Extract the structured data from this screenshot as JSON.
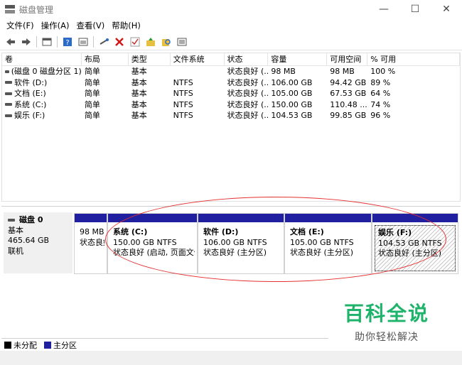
{
  "window": {
    "title": "磁盘管理",
    "minimize": "—",
    "maximize": "☐",
    "close": "✕"
  },
  "menu": [
    "文件(F)",
    "操作(A)",
    "查看(V)",
    "帮助(H)"
  ],
  "columns": [
    "卷",
    "布局",
    "类型",
    "文件系统",
    "状态",
    "容量",
    "可用空间",
    "% 可用"
  ],
  "volumes": [
    [
      "(磁盘 0 磁盘分区 1)",
      "简单",
      "基本",
      "",
      "状态良好 (...",
      "98 MB",
      "98 MB",
      "100 %"
    ],
    [
      "软件 (D:)",
      "简单",
      "基本",
      "NTFS",
      "状态良好 (...",
      "106.00 GB",
      "94.42 GB",
      "89 %"
    ],
    [
      "文档 (E:)",
      "简单",
      "基本",
      "NTFS",
      "状态良好 (...",
      "105.00 GB",
      "67.53 GB",
      "64 %"
    ],
    [
      "系统 (C:)",
      "简单",
      "基本",
      "NTFS",
      "状态良好 (...",
      "150.00 GB",
      "110.48 ...",
      "74 %"
    ],
    [
      "娱乐 (F:)",
      "简单",
      "基本",
      "NTFS",
      "状态良好 (...",
      "104.53 GB",
      "99.85 GB",
      "96 %"
    ]
  ],
  "disk": {
    "name": "磁盘 0",
    "type": "基本",
    "size": "465.64 GB",
    "status": "联机"
  },
  "partitions": [
    {
      "name": "",
      "size": "98 MB",
      "status": "状态良好"
    },
    {
      "name": "系统  (C:)",
      "size": "150.00 GB NTFS",
      "status": "状态良好 (启动, 页面文件"
    },
    {
      "name": "软件  (D:)",
      "size": "106.00 GB NTFS",
      "status": "状态良好 (主分区)"
    },
    {
      "name": "文档  (E:)",
      "size": "105.00 GB NTFS",
      "status": "状态良好 (主分区)"
    },
    {
      "name": "娱乐  (F:)",
      "size": "104.53 GB NTFS",
      "status": "状态良好 (主分区)"
    }
  ],
  "legend": [
    {
      "label": "未分配",
      "color": "#000000"
    },
    {
      "label": "主分区",
      "color": "#1f1fa0"
    }
  ],
  "watermark": {
    "main": "百科全说",
    "sub": "助你轻松解决"
  },
  "colors": {
    "partition_bar": "#1f1fa0",
    "annotation": "#e53030",
    "watermark": "#1db36a"
  },
  "toolbar_icons": [
    "back-icon",
    "forward-icon",
    "properties-icon",
    "help-icon",
    "console-icon",
    "connect-icon",
    "delete-icon",
    "check-icon",
    "folder-up-icon",
    "find-icon",
    "list-icon"
  ]
}
